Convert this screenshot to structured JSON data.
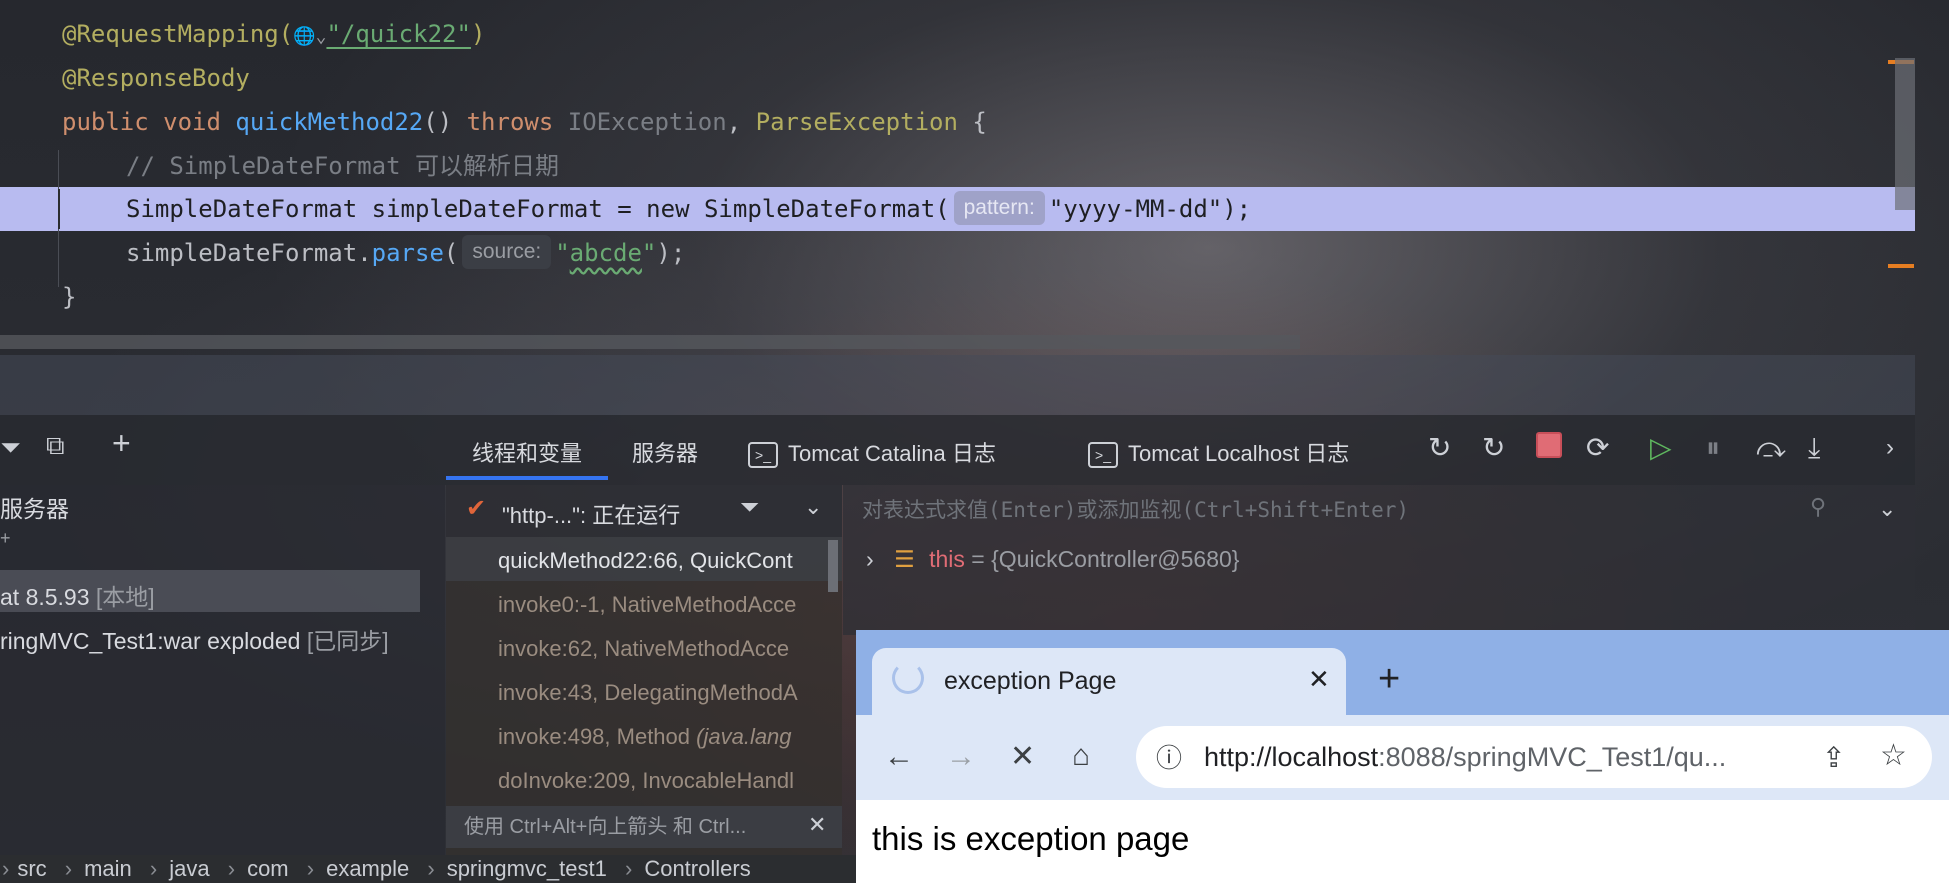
{
  "editor": {
    "line1": {
      "annotation": "@RequestMapping(",
      "globe": "🌐⌄",
      "url": "\"/quick22\"",
      "close": ")"
    },
    "line2": {
      "annotation": "@ResponseBody"
    },
    "line3": {
      "public": "public",
      "void": "void",
      "method": "quickMethod22",
      "parens": "()",
      "throws": "throws",
      "ex1": "IOException",
      "comma": ",",
      "ex2": "ParseException",
      "brace": "{"
    },
    "line4": {
      "comment": "// SimpleDateFormat 可以解析日期"
    },
    "line5": {
      "before": "SimpleDateFormat simpleDateFormat = new SimpleDateFormat(",
      "hint": "pattern:",
      "after": "\"yyyy-MM-dd\");"
    },
    "line6": {
      "obj": "simpleDateFormat.",
      "method": "parse",
      "open": "(",
      "hint": "source:",
      "quote1": "\"",
      "value": "abcde",
      "quote2": "\"",
      "close": ");"
    },
    "line7": {
      "brace": "}"
    }
  },
  "panel": {
    "tabs": [
      "线程和变量",
      "服务器",
      "Tomcat Catalina 日志",
      "Tomcat Localhost 日志"
    ],
    "tree": {
      "item1": "服务器",
      "item2": "+",
      "item3_name": "at 8.5.93",
      "item3_tag": "[本地]",
      "item4_name": "ringMVC_Test1:war exploded",
      "item4_tag": "[已同步]"
    },
    "thread": {
      "name": "\"http-...\": 正在运行"
    },
    "frames": [
      {
        "method": "quickMethod22:66, QuickCont",
        "pkg": ""
      },
      {
        "method": "invoke0:-1, NativeMethodAcce",
        "pkg": ""
      },
      {
        "method": "invoke:62, NativeMethodAcce",
        "pkg": ""
      },
      {
        "method": "invoke:43, DelegatingMethodA",
        "pkg": ""
      },
      {
        "method": "invoke:498, Method ",
        "pkg": "(java.lang"
      },
      {
        "method": "doInvoke:209, InvocableHandl",
        "pkg": ""
      }
    ],
    "hint_bar": "使用 Ctrl+Alt+向上箭头 和 Ctrl...",
    "eval_placeholder": "对表达式求值(Enter)或添加监视(Ctrl+Shift+Enter)",
    "variable": {
      "name": "this",
      "eq": " = ",
      "value": "{QuickController@5680}"
    }
  },
  "breadcrumb": [
    "src",
    "main",
    "java",
    "com",
    "example",
    "springmvc_test1",
    "Controllers"
  ],
  "browser": {
    "tab_title": "exception Page",
    "url_host": "http://localhost",
    "url_rest": ":8088/springMVC_Test1/qu...",
    "content": "this is exception page"
  },
  "colors": {
    "highlight": "#b8bbf0",
    "accent": "#3574f0",
    "stop": "#e06c75",
    "resume": "#5fb85f"
  }
}
